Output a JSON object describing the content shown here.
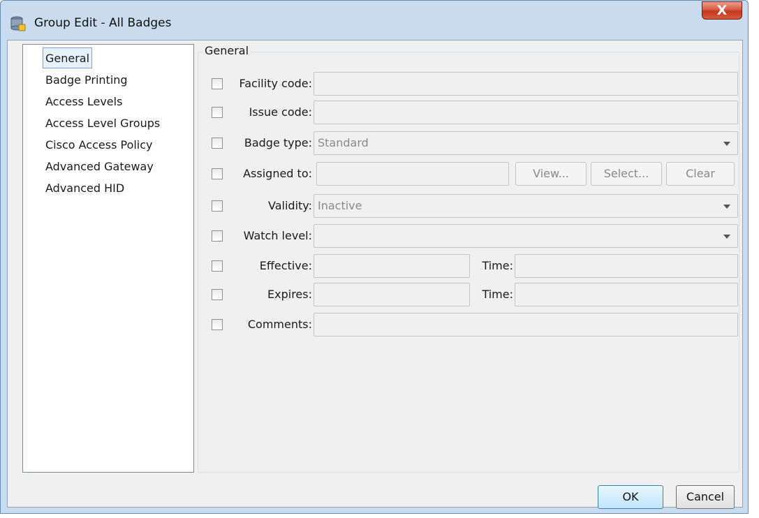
{
  "window": {
    "title": "Group Edit - All Badges",
    "close_label": "X"
  },
  "nav": {
    "items": [
      {
        "label": "General"
      },
      {
        "label": "Badge Printing"
      },
      {
        "label": "Access Levels"
      },
      {
        "label": "Access Level Groups"
      },
      {
        "label": "Cisco Access Policy"
      },
      {
        "label": "Advanced Gateway"
      },
      {
        "label": "Advanced HID"
      }
    ],
    "selected": "General"
  },
  "group": {
    "title": "General"
  },
  "fields": {
    "facility_code": {
      "label": "Facility code:",
      "value": ""
    },
    "issue_code": {
      "label": "Issue code:",
      "value": ""
    },
    "badge_type": {
      "label": "Badge type:",
      "value": "Standard"
    },
    "assigned_to": {
      "label": "Assigned to:",
      "value": ""
    },
    "validity": {
      "label": "Validity:",
      "value": "Inactive"
    },
    "watch_level": {
      "label": "Watch level:",
      "value": ""
    },
    "effective": {
      "label": "Effective:",
      "value": "",
      "time_label": "Time:",
      "time_value": ""
    },
    "expires": {
      "label": "Expires:",
      "value": "",
      "time_label": "Time:",
      "time_value": ""
    },
    "comments": {
      "label": "Comments:",
      "value": ""
    }
  },
  "assigned_buttons": {
    "view": "View...",
    "select": "Select...",
    "clear": "Clear"
  },
  "footer": {
    "ok": "OK",
    "cancel": "Cancel"
  },
  "colors": {
    "title_bg": "#c9dcef",
    "client_bg": "#f0f0f0",
    "close_red": "#c23a1c",
    "selection": "#e5f1fb"
  },
  "icons": {
    "app": "database-icon",
    "dropdown": "chevron-down-icon"
  }
}
